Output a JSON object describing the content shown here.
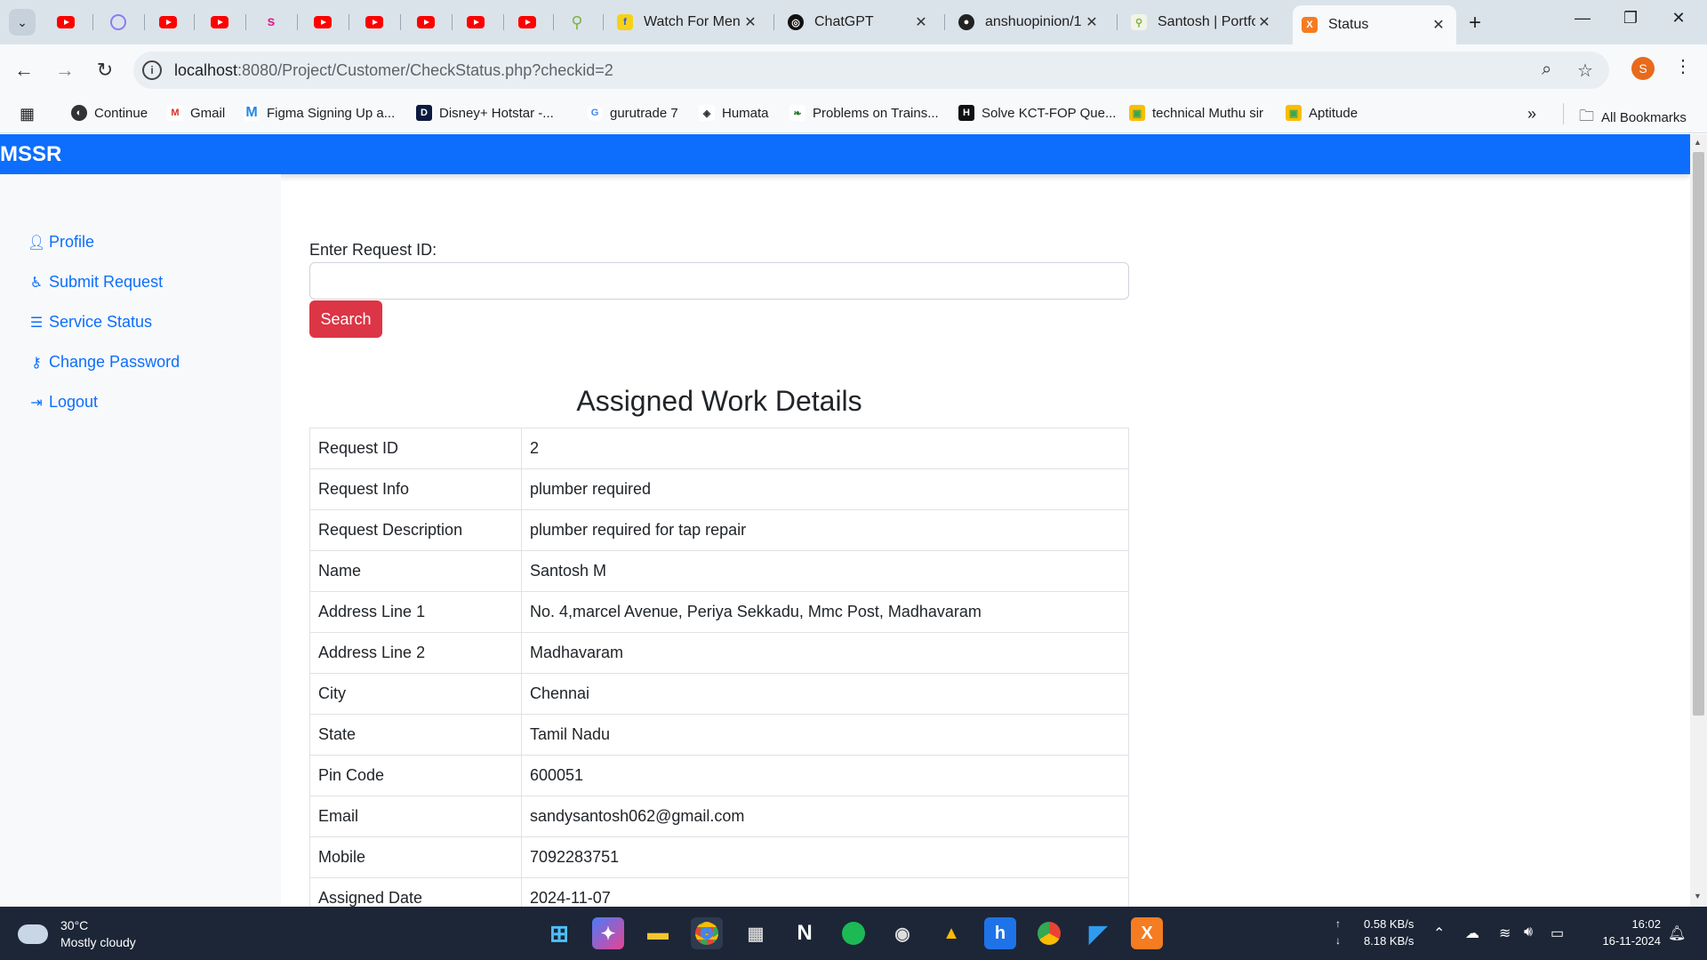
{
  "browser": {
    "tabs": [
      {
        "title": "Watch For Men"
      },
      {
        "title": "ChatGPT"
      },
      {
        "title": "anshuopinion/1"
      },
      {
        "title": "Santosh | Portfo"
      },
      {
        "title": "Status"
      }
    ],
    "url_host": "localhost",
    "url_rest": ":8080/Project/Customer/CheckStatus.php?checkid=2",
    "avatar_letter": "S",
    "bookmarks": [
      {
        "label": "Continue"
      },
      {
        "label": "Gmail"
      },
      {
        "label": "Figma Signing Up a..."
      },
      {
        "label": "Disney+ Hotstar -..."
      },
      {
        "label": "gurutrade 7"
      },
      {
        "label": "Humata"
      },
      {
        "label": "Problems on Trains..."
      },
      {
        "label": "Solve KCT-FOP Que..."
      },
      {
        "label": "technical Muthu sir"
      },
      {
        "label": "Aptitude"
      }
    ],
    "all_bookmarks": "All Bookmarks"
  },
  "app": {
    "brand": "MSSR",
    "sidebar": [
      {
        "label": "Profile",
        "icon": "user-icon"
      },
      {
        "label": "Submit Request",
        "icon": "accessibility-icon"
      },
      {
        "label": "Service Status",
        "icon": "list-icon"
      },
      {
        "label": "Change Password",
        "icon": "key-icon"
      },
      {
        "label": "Logout",
        "icon": "logout-icon"
      }
    ],
    "form": {
      "label": "Enter Request ID:",
      "value": "",
      "button": "Search"
    },
    "details_title": "Assigned Work Details",
    "details": [
      {
        "key": "Request ID",
        "value": "2"
      },
      {
        "key": "Request Info",
        "value": "plumber required"
      },
      {
        "key": "Request Description",
        "value": "plumber required for tap repair"
      },
      {
        "key": "Name",
        "value": "Santosh M"
      },
      {
        "key": "Address Line 1",
        "value": "No. 4,marcel Avenue, Periya Sekkadu, Mmc Post, Madhavaram"
      },
      {
        "key": "Address Line 2",
        "value": "Madhavaram"
      },
      {
        "key": "City",
        "value": "Chennai"
      },
      {
        "key": "State",
        "value": "Tamil Nadu"
      },
      {
        "key": "Pin Code",
        "value": "600051"
      },
      {
        "key": "Email",
        "value": "sandysantosh062@gmail.com"
      },
      {
        "key": "Mobile",
        "value": "7092283751"
      },
      {
        "key": "Assigned Date",
        "value": "2024-11-07"
      }
    ]
  },
  "taskbar": {
    "temp": "30°C",
    "condition": "Mostly cloudy",
    "upload_speed": "0.58 KB/s",
    "download_speed": "8.18 KB/s",
    "time": "16:02",
    "date": "16-11-2024"
  },
  "colors": {
    "primary": "#0d6efd",
    "danger": "#dc3545",
    "sidebar_bg": "#f8f9fa"
  }
}
